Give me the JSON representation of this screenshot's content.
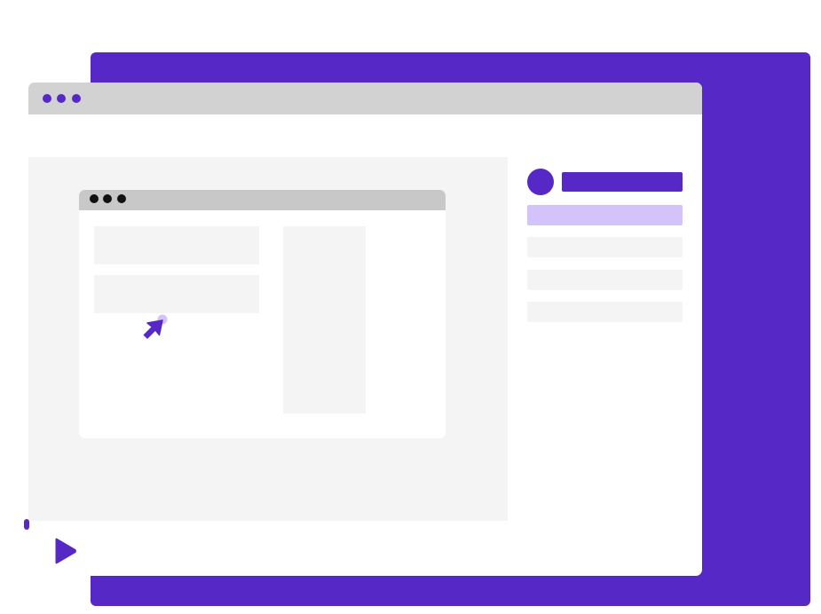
{
  "colors": {
    "accent": "#5628c6",
    "accent_light": "#d3c3fa",
    "titlebar": "#d2d2d2",
    "inner_titlebar": "#c8c8c8",
    "placeholder": "#f4f4f4",
    "inner_dot": "#111111"
  },
  "player": {
    "progress_fraction": 0.0,
    "play_icon": "play-icon"
  },
  "sidebar": {
    "selected_index": 0,
    "item_count": 4
  },
  "icons": {
    "cursor": "cursor-arrow-icon",
    "avatar": "avatar-circle"
  }
}
